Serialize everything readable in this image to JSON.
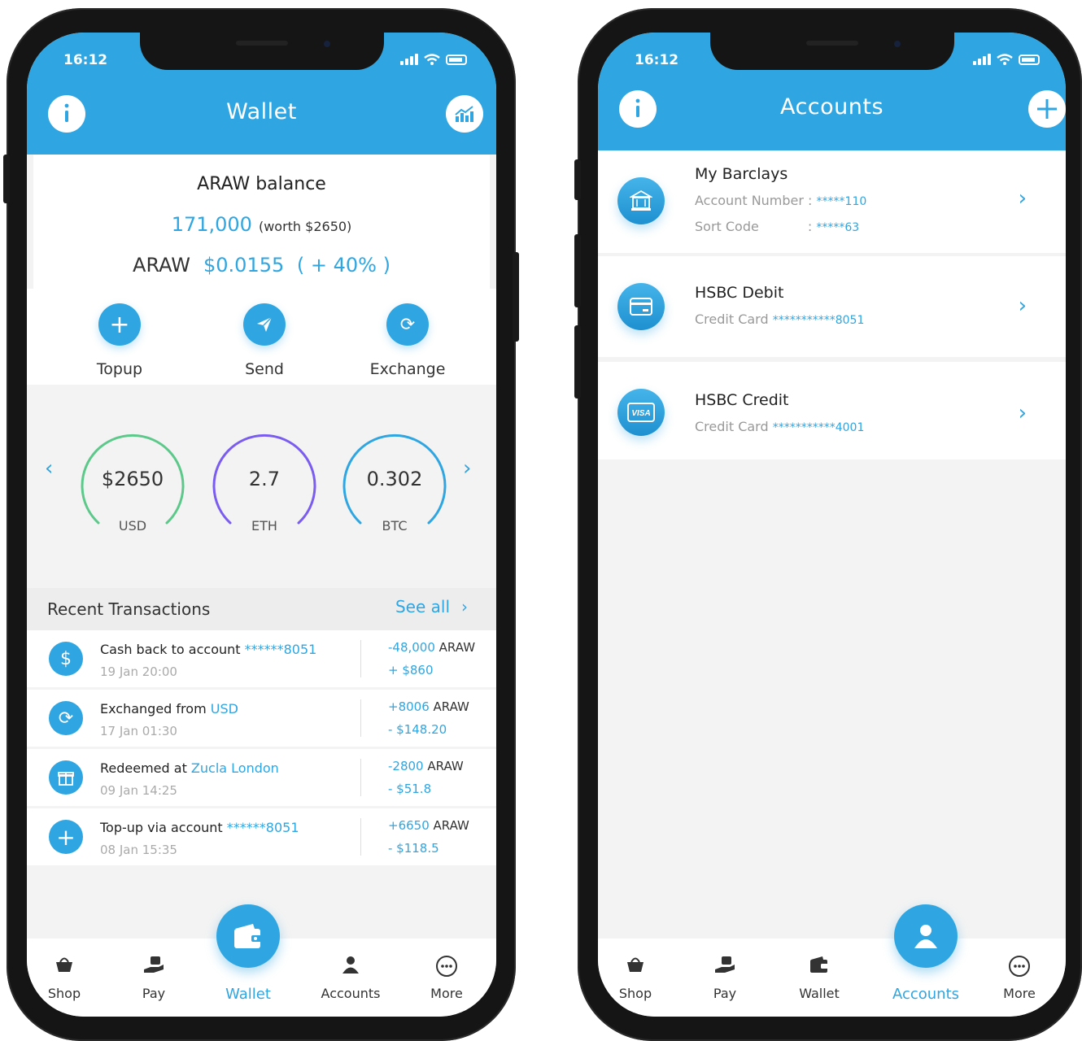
{
  "status": {
    "time": "16:12"
  },
  "wallet": {
    "title": "Wallet",
    "balance": {
      "title": "ARAW balance",
      "amount": "171,000",
      "worth": "(worth $2650)",
      "symbol": "ARAW",
      "price": "$0.0155",
      "change": "( + 40% )"
    },
    "actions": [
      {
        "label": "Topup",
        "icon": "plus-icon"
      },
      {
        "label": "Send",
        "icon": "paper-plane-icon"
      },
      {
        "label": "Exchange",
        "icon": "exchange-icon"
      }
    ],
    "gauges": [
      {
        "value": "$2650",
        "unit": "USD",
        "color": "#5cc98a"
      },
      {
        "value": "2.7",
        "unit": "ETH",
        "color": "#7a5cf0"
      },
      {
        "value": "0.302",
        "unit": "BTC",
        "color": "#2fa6e1"
      }
    ],
    "recent": {
      "title": "Recent Transactions",
      "see_all": "See all",
      "items": [
        {
          "icon": "cashback-icon",
          "text": "Cash back to account ",
          "highlight": "******8051",
          "date": "19 Jan 20:00",
          "araw": "-48,000",
          "araw_unit": " ARAW",
          "usd": "+ $860"
        },
        {
          "icon": "exchange-icon",
          "text": "Exchanged from ",
          "highlight": "USD",
          "date": "17 Jan 01:30",
          "araw": "+8006",
          "araw_unit": " ARAW",
          "usd": "- $148.20"
        },
        {
          "icon": "gift-icon",
          "text": "Redeemed at ",
          "highlight": "Zucla London",
          "date": "09 Jan 14:25",
          "araw": "-2800",
          "araw_unit": " ARAW",
          "usd": "- $51.8"
        },
        {
          "icon": "plus-icon",
          "text": "Top-up via account ",
          "highlight": "******8051",
          "date": "08 Jan 15:35",
          "araw": "+6650",
          "araw_unit": " ARAW",
          "usd": "- $118.5"
        }
      ]
    }
  },
  "accounts": {
    "title": "Accounts",
    "items": [
      {
        "name": "My Barclays",
        "icon": "bank-icon",
        "line1_label": "Account Number :",
        "line1_value": "*****110",
        "line2_label": "Sort Code",
        "line2_value": "*****63"
      },
      {
        "name": "HSBC Debit",
        "icon": "card-icon",
        "line1_label": "Credit Card",
        "line1_value": "***********8051"
      },
      {
        "name": "HSBC Credit",
        "icon": "visa-icon",
        "line1_label": "Credit Card",
        "line1_value": "***********4001"
      }
    ]
  },
  "tabs": {
    "shop": "Shop",
    "pay": "Pay",
    "wallet": "Wallet",
    "accounts": "Accounts",
    "more": "More"
  },
  "colors": {
    "accent": "#2fa6e1"
  }
}
